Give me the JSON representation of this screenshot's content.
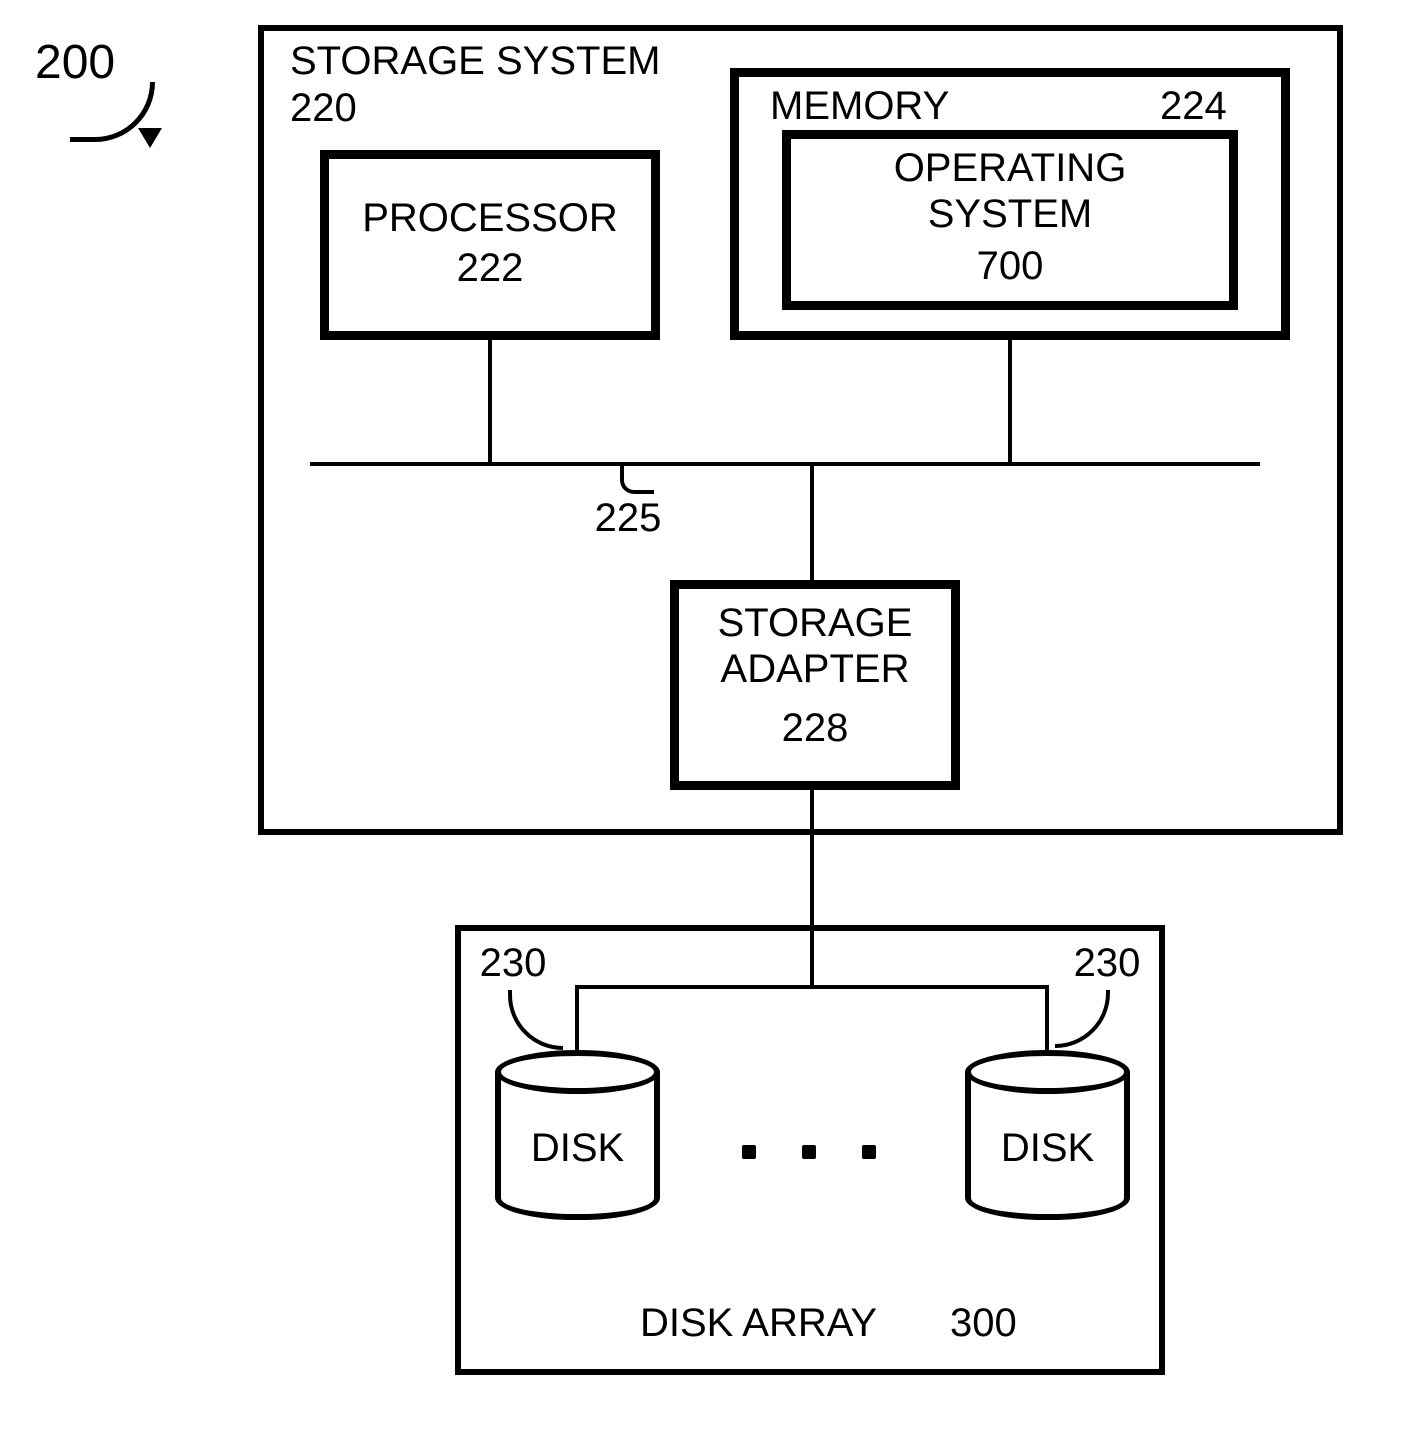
{
  "fig_ref": "200",
  "storage_system": {
    "title": "STORAGE SYSTEM",
    "ref": "220"
  },
  "processor": {
    "title": "PROCESSOR",
    "ref": "222"
  },
  "memory": {
    "title": "MEMORY",
    "ref": "224"
  },
  "operating_system": {
    "title": "OPERATING\nSYSTEM",
    "ref": "700"
  },
  "bus_ref": "225",
  "storage_adapter": {
    "title": "STORAGE\nADAPTER",
    "ref": "228"
  },
  "disk_left": {
    "label": "DISK",
    "ref": "230"
  },
  "disk_right": {
    "label": "DISK",
    "ref": "230"
  },
  "disk_array": {
    "title": "DISK ARRAY",
    "ref": "300"
  }
}
